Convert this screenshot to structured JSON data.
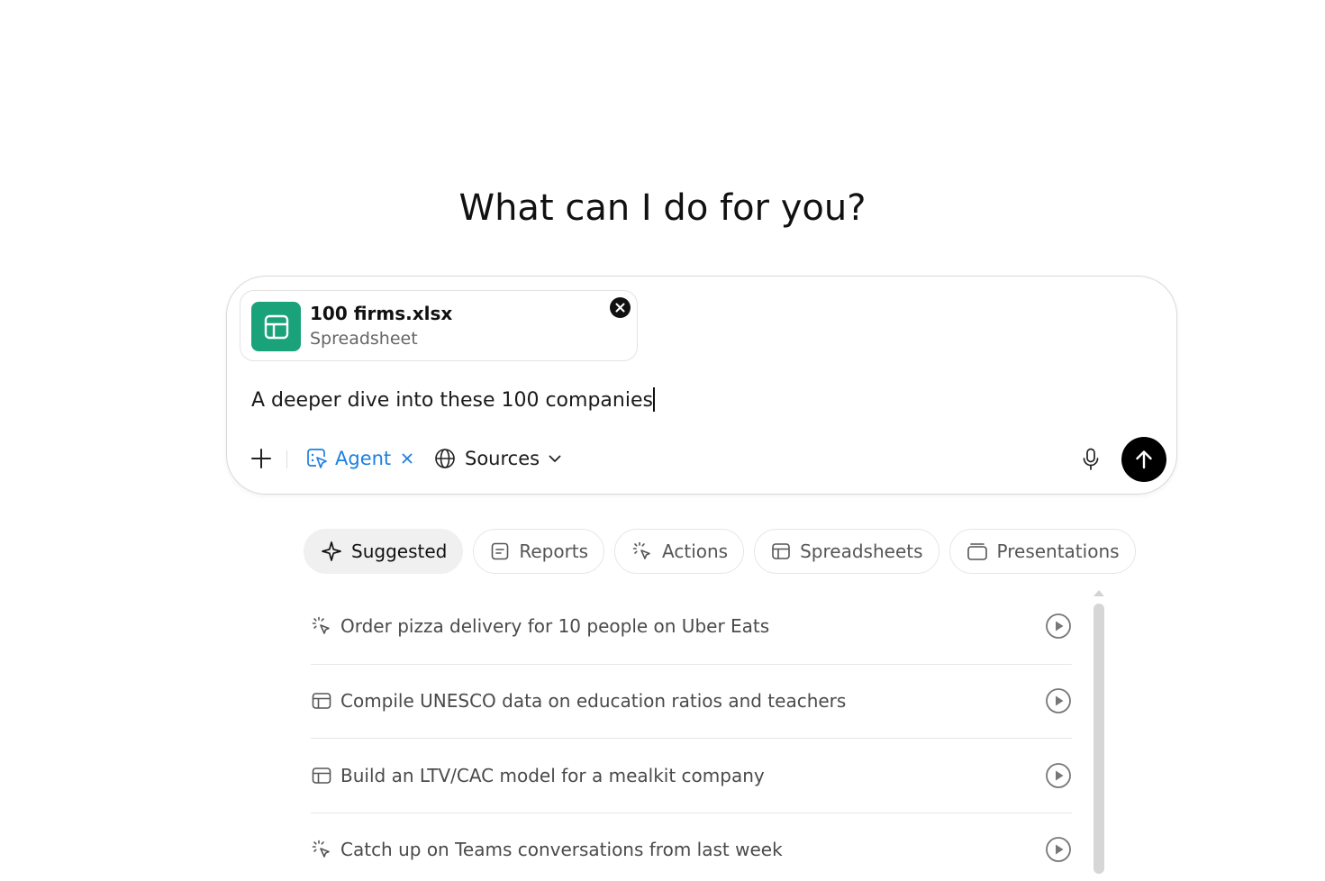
{
  "heading": "What can I do for you?",
  "attachment": {
    "name": "100 firms.xlsx",
    "type": "Spreadsheet"
  },
  "prompt": {
    "value": "A deeper dive into these 100 companies"
  },
  "toolbar": {
    "agent_label": "Agent",
    "sources_label": "Sources"
  },
  "tabs": [
    {
      "label": "Suggested",
      "icon": "sparkle-icon",
      "active": true
    },
    {
      "label": "Reports",
      "icon": "document-icon"
    },
    {
      "label": "Actions",
      "icon": "cursor-click-icon"
    },
    {
      "label": "Spreadsheets",
      "icon": "table-icon"
    },
    {
      "label": "Presentations",
      "icon": "slides-icon"
    }
  ],
  "suggestions": [
    {
      "text": "Order pizza delivery for 10 people on Uber Eats",
      "icon": "cursor-click-icon"
    },
    {
      "text": "Compile UNESCO data on education ratios and teachers",
      "icon": "table-icon"
    },
    {
      "text": "Build an LTV/CAC model for a mealkit company",
      "icon": "table-icon"
    },
    {
      "text": "Catch up on Teams conversations from last week",
      "icon": "cursor-click-icon"
    }
  ],
  "colors": {
    "agent_accent": "#1d7fe0",
    "spreadsheet_green": "#1aa37a",
    "send_button": "#000000"
  }
}
